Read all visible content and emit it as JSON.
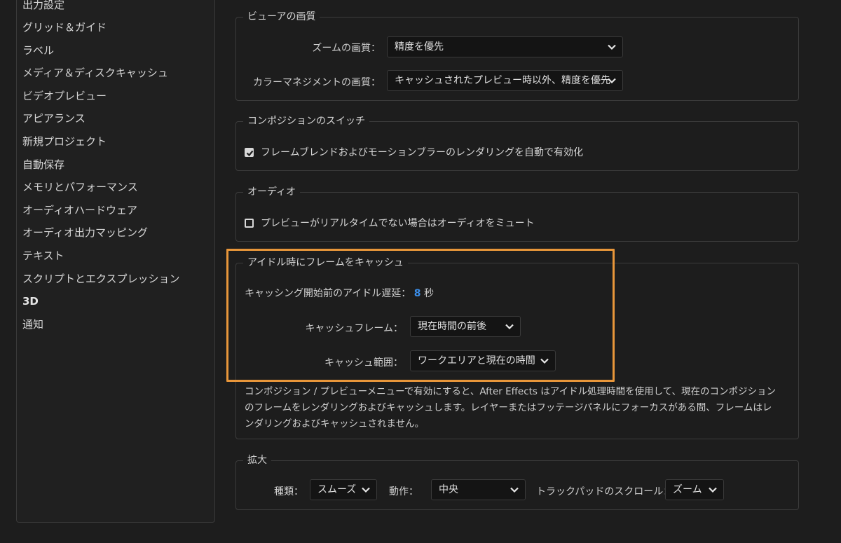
{
  "sidebar": {
    "items": [
      {
        "label": "出力設定"
      },
      {
        "label": "グリッド＆ガイド"
      },
      {
        "label": "ラベル"
      },
      {
        "label": "メディア＆ディスクキャッシュ"
      },
      {
        "label": "ビデオプレビュー"
      },
      {
        "label": "アピアランス"
      },
      {
        "label": "新規プロジェクト"
      },
      {
        "label": "自動保存"
      },
      {
        "label": "メモリとパフォーマンス"
      },
      {
        "label": "オーディオハードウェア"
      },
      {
        "label": "オーディオ出力マッピング"
      },
      {
        "label": "テキスト"
      },
      {
        "label": "スクリプトとエクスプレッション"
      },
      {
        "label": "3D"
      },
      {
        "label": "通知"
      }
    ]
  },
  "viewer_quality": {
    "title": "ビューアの画質",
    "zoom_label": "ズームの画質：",
    "zoom_value": "精度を優先",
    "color_label": "カラーマネジメントの画質：",
    "color_value": "キャッシュされたプレビュー時以外、精度を優先"
  },
  "composition_switch": {
    "title": "コンポジションのスイッチ",
    "frame_blend_label": "フレームブレンドおよびモーションブラーのレンダリングを自動で有効化",
    "frame_blend_checked": true
  },
  "audio": {
    "title": "オーディオ",
    "mute_label": "プレビューがリアルタイムでない場合はオーディオをミュート",
    "mute_checked": false
  },
  "idle_cache": {
    "title": "アイドル時にフレームをキャッシュ",
    "delay_label": "キャッシング開始前のアイドル遅延：",
    "delay_value": "8",
    "delay_unit": "秒",
    "frames_label": "キャッシュフレーム：",
    "frames_value": "現在時間の前後",
    "range_label": "キャッシュ範囲：",
    "range_value": "ワークエリアと現在の時間",
    "description": "コンポジション / プレビューメニューで有効にすると、After Effects はアイドル処理時間を使用して、現在のコンポジションのフレームをレンダリングおよびキャッシュします。レイヤーまたはフッテージパネルにフォーカスがある間、フレームはレンダリングおよびキャッシュされません。"
  },
  "zoom_section": {
    "title": "拡大",
    "type_label": "種類：",
    "type_value": "スムーズ",
    "action_label": "動作：",
    "action_value": "中央",
    "trackpad_label": "トラックパッドのスクロール：",
    "trackpad_value": "ズーム"
  },
  "colors": {
    "highlight": "#e8963a",
    "accent": "#3b8eea"
  }
}
